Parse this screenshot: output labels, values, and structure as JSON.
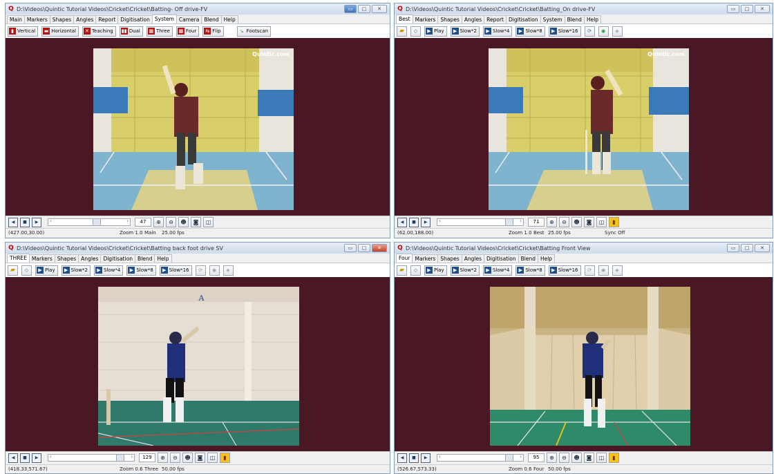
{
  "brand_text": "Quintic.com",
  "windows": [
    {
      "title": "D:\\Videos\\Quintic Tutorial Videos\\Cricket\\Cricket\\Batting- Off drive-FV",
      "tabs": [
        "Main",
        "Markers",
        "Shapes",
        "Angles",
        "Report",
        "Digitisation",
        "System",
        "Camera",
        "Blend",
        "Help"
      ],
      "active_tab": "System",
      "toolbar": [
        {
          "icon": "layout-vertical-icon",
          "label": "Vertical"
        },
        {
          "icon": "layout-horizontal-icon",
          "label": "Horizontal"
        },
        {
          "icon": "teaching-icon",
          "label": "Teaching"
        },
        {
          "icon": "dual-icon",
          "label": "Dual"
        },
        {
          "icon": "three-icon",
          "label": "Three"
        },
        {
          "icon": "four-icon",
          "label": "Four"
        },
        {
          "icon": "flip-icon",
          "label": "Flip"
        },
        {
          "icon": "footscan-icon",
          "label": "Footscan"
        }
      ],
      "frame": "47",
      "status": {
        "coords": "(427.00,30.00)",
        "zoom": "Zoom 1.0",
        "view": "Main",
        "fps": "25.00 fps",
        "sync": ""
      }
    },
    {
      "title": "D:\\Videos\\Quintic Tutorial Videos\\Cricket\\Cricket\\Batting_On drive-FV",
      "tabs": [
        "Best",
        "Markers",
        "Shapes",
        "Angles",
        "Report",
        "Digitisation",
        "System",
        "Blend",
        "Help"
      ],
      "active_tab": "Best",
      "toolbar": [
        {
          "icon": "open-folder-icon",
          "label": ""
        },
        {
          "icon": "eraser-icon",
          "label": ""
        },
        {
          "icon": "play-icon",
          "label": "Play"
        },
        {
          "icon": "play-icon",
          "label": "Slow*2"
        },
        {
          "icon": "play-icon",
          "label": "Slow*4"
        },
        {
          "icon": "play-icon",
          "label": "Slow*8"
        },
        {
          "icon": "play-icon",
          "label": "Slow*16"
        },
        {
          "icon": "sync-icon",
          "label": ""
        },
        {
          "icon": "record-icon",
          "label": ""
        },
        {
          "icon": "audio-icon",
          "label": ""
        }
      ],
      "frame": "71",
      "status": {
        "coords": "(62.00,188.00)",
        "zoom": "Zoom 1.0",
        "view": "Best",
        "fps": "25.00 fps",
        "sync": "Sync Off"
      }
    },
    {
      "title": "D:\\Videos\\Quintic Tutorial Videos\\Cricket\\Cricket\\Batting back foot drive SV",
      "tabs": [
        "THREE",
        "Markers",
        "Shapes",
        "Angles",
        "Digitisation",
        "Blend",
        "Help"
      ],
      "active_tab": "THREE",
      "toolbar": [
        {
          "icon": "open-folder-icon",
          "label": ""
        },
        {
          "icon": "eraser-icon",
          "label": ""
        },
        {
          "icon": "play-icon",
          "label": "Play"
        },
        {
          "icon": "play-icon",
          "label": "Slow*2"
        },
        {
          "icon": "play-icon",
          "label": "Slow*4"
        },
        {
          "icon": "play-icon",
          "label": "Slow*8"
        },
        {
          "icon": "play-icon",
          "label": "Slow*16"
        },
        {
          "icon": "sync-icon",
          "label": ""
        },
        {
          "icon": "record-icon",
          "label": ""
        },
        {
          "icon": "audio-icon",
          "label": ""
        }
      ],
      "frame": "129",
      "video_letter": "A",
      "status": {
        "coords": "(418.33,571.67)",
        "zoom": "Zoom 0.6",
        "view": "Three",
        "fps": "50.00 fps",
        "sync": ""
      }
    },
    {
      "title": "D:\\Videos\\Quintic Tutorial Videos\\Cricket\\Cricket\\Batting  Front View",
      "tabs": [
        "Four",
        "Markers",
        "Shapes",
        "Angles",
        "Digitisation",
        "Blend",
        "Help"
      ],
      "active_tab": "Four",
      "toolbar": [
        {
          "icon": "open-folder-icon",
          "label": ""
        },
        {
          "icon": "eraser-icon",
          "label": ""
        },
        {
          "icon": "play-icon",
          "label": "Play"
        },
        {
          "icon": "play-icon",
          "label": "Slow*2"
        },
        {
          "icon": "play-icon",
          "label": "Slow*4"
        },
        {
          "icon": "play-icon",
          "label": "Slow*8"
        },
        {
          "icon": "play-icon",
          "label": "Slow*16"
        },
        {
          "icon": "sync-icon",
          "label": ""
        },
        {
          "icon": "record-icon",
          "label": ""
        },
        {
          "icon": "audio-icon",
          "label": ""
        }
      ],
      "frame": "95",
      "status": {
        "coords": "(526.67,573.33)",
        "zoom": "Zoom 0.6",
        "view": "Four",
        "fps": "50.00 fps",
        "sync": ""
      }
    }
  ],
  "colors": {
    "video_background": "#4a1824",
    "titlebar": "#dbe6f3",
    "accent_red": "#b01818"
  }
}
